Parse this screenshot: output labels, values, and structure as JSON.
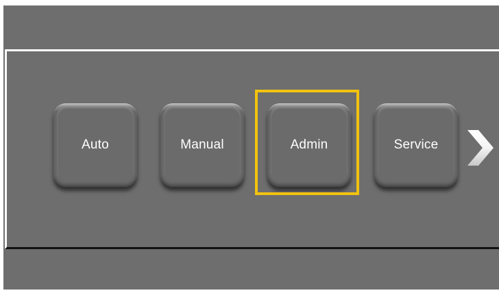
{
  "modes": {
    "auto_label": "Auto",
    "manual_label": "Manual",
    "admin_label": "Admin",
    "service_label": "Service",
    "selected": "Admin"
  },
  "icons": {
    "next": "chevron-right-icon"
  },
  "colors": {
    "background": "#6e6e6e",
    "button_face": "#6b6b6b",
    "selection_highlight": "#f2c30f",
    "label": "#ffffff"
  }
}
